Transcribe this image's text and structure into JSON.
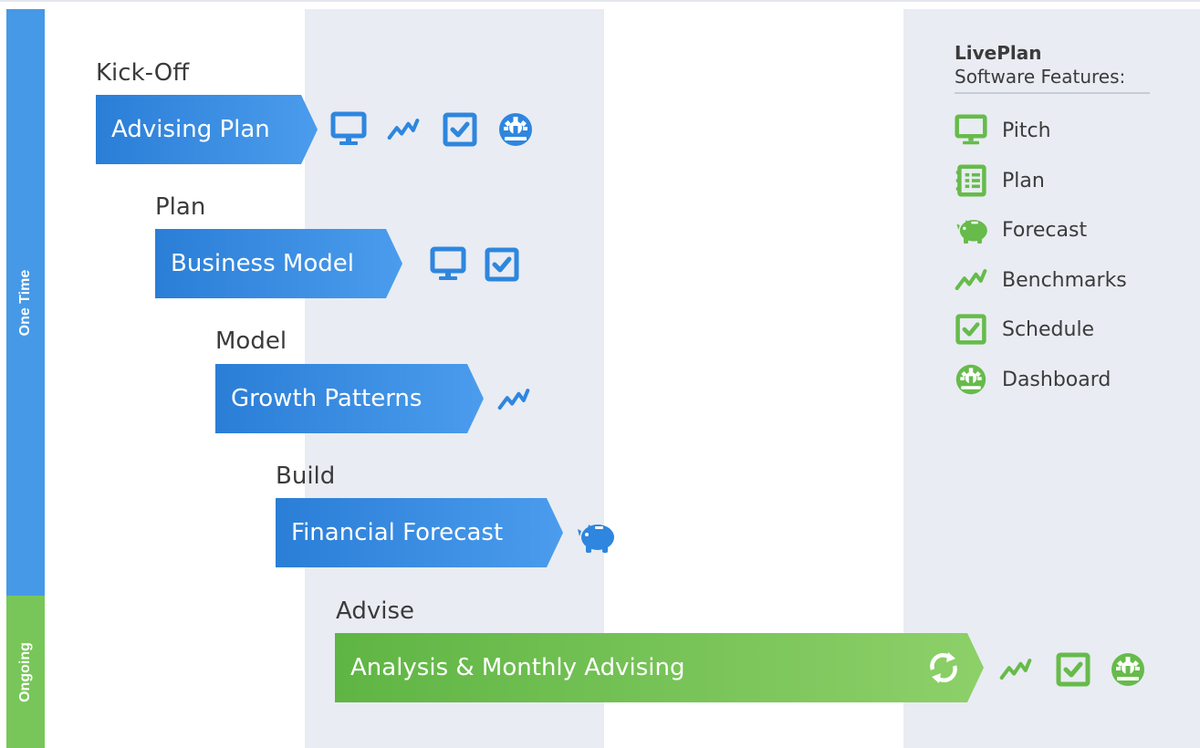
{
  "side": {
    "one_time": "One Time",
    "ongoing": "Ongoing"
  },
  "stages": [
    {
      "label": "Kick-Off",
      "step": "Advising Plan"
    },
    {
      "label": "Plan",
      "step": "Business Model"
    },
    {
      "label": "Model",
      "step": "Growth Patterns"
    },
    {
      "label": "Build",
      "step": "Financial Forecast"
    },
    {
      "label": "Advise",
      "step": "Analysis & Monthly Advising"
    }
  ],
  "legend": {
    "title": "LivePlan",
    "subtitle": "Software Features:",
    "items": [
      {
        "label": "Pitch",
        "icon": "monitor-icon"
      },
      {
        "label": "Plan",
        "icon": "plan-icon"
      },
      {
        "label": "Forecast",
        "icon": "piggy-bank-icon"
      },
      {
        "label": "Benchmarks",
        "icon": "benchmarks-icon"
      },
      {
        "label": "Schedule",
        "icon": "schedule-icon"
      },
      {
        "label": "Dashboard",
        "icon": "dashboard-icon"
      }
    ]
  },
  "colors": {
    "blue": "#2a7ed6",
    "green": "#6abf4b",
    "band": "#e9ecf3"
  }
}
